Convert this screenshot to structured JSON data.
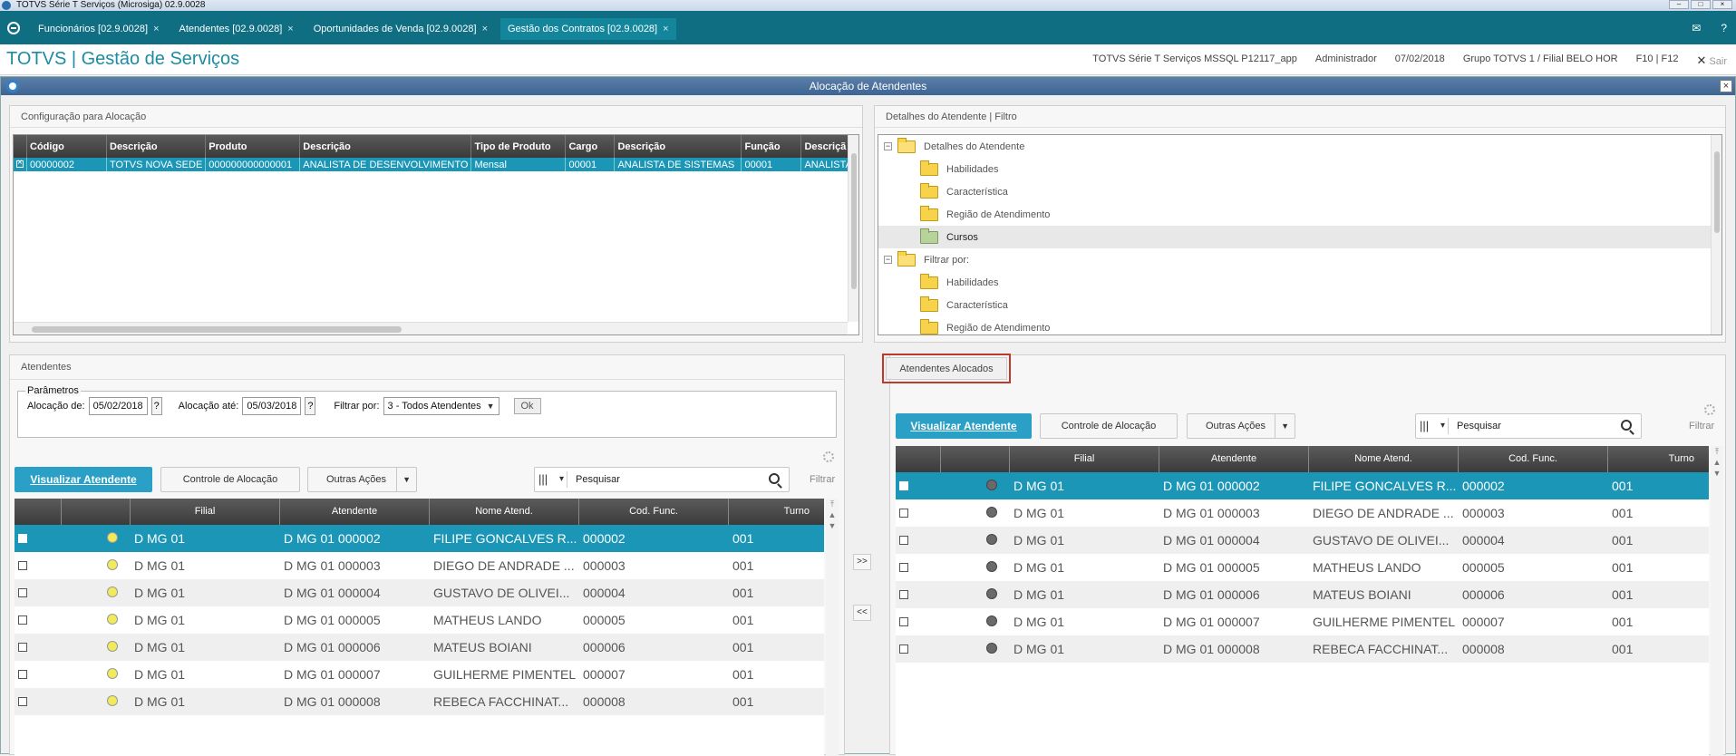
{
  "os": {
    "title": "TOTVS Série T Serviços (Microsiga) 02.9.0028"
  },
  "tabs": [
    {
      "label": "Funcionários [02.9.0028]"
    },
    {
      "label": "Atendentes [02.9.0028]"
    },
    {
      "label": "Oportunidades de Venda [02.9.0028]"
    },
    {
      "label": "Gestão dos Contratos [02.9.0028]"
    }
  ],
  "header": {
    "brand": "TOTVS | Gestão de Serviços",
    "environment": "TOTVS Série T Serviços MSSQL P12117_app",
    "user": "Administrador",
    "date": "07/02/2018",
    "company": "Grupo TOTVS 1 / Filial BELO HOR",
    "keys": "F10 | F12",
    "logout": "Sair"
  },
  "dialog": {
    "title": "Alocação de Atendentes"
  },
  "config": {
    "title": "Configuração para Alocação",
    "columns": [
      "Código",
      "Descrição",
      "Produto",
      "Descrição",
      "Tipo de Produto",
      "Cargo",
      "Descrição",
      "Função",
      "Descriçã"
    ],
    "row": [
      "00000002",
      "TOTVS NOVA SEDE",
      "000000000000001",
      "ANALISTA DE DESENVOLVIMENTO",
      "Mensal",
      "00001",
      "ANALISTA DE SISTEMAS",
      "00001",
      "ANALISTA"
    ]
  },
  "details": {
    "title": "Detalhes do Atendente | Filtro",
    "tree": [
      {
        "label": "Detalhes do Atendente",
        "level": 0
      },
      {
        "label": "Habilidades",
        "level": 1
      },
      {
        "label": "Característica",
        "level": 1
      },
      {
        "label": "Região de Atendimento",
        "level": 1
      },
      {
        "label": "Cursos",
        "level": 1,
        "selected": true
      },
      {
        "label": "Filtrar por:",
        "level": 0
      },
      {
        "label": "Habilidades",
        "level": 1
      },
      {
        "label": "Característica",
        "level": 1
      },
      {
        "label": "Região de Atendimento",
        "level": 1
      }
    ]
  },
  "atendentes": {
    "title": "Atendentes",
    "params": {
      "legend": "Parâmetros",
      "from_label": "Alocação de:",
      "from_value": "05/02/2018",
      "to_label": "Alocação até:",
      "to_value": "05/03/2018",
      "filter_label": "Filtrar por:",
      "filter_value": "3 - Todos Atendentes",
      "ok_label": "Ok"
    }
  },
  "toolbar": {
    "view_label": "Visualizar Atendente",
    "control_label": "Controle de Alocação",
    "more_label": "Outras Ações",
    "search_placeholder": "Pesquisar",
    "filter_label": "Filtrar"
  },
  "grid_columns": [
    "Filial",
    "Atendente",
    "Nome Atend.",
    "Cod. Func.",
    "Turno"
  ],
  "grid_rows": [
    [
      "D MG 01",
      "D MG 01 000002",
      "FILIPE GONCALVES R...",
      "000002",
      "001"
    ],
    [
      "D MG 01",
      "D MG 01 000003",
      "DIEGO DE ANDRADE ...",
      "000003",
      "001"
    ],
    [
      "D MG 01",
      "D MG 01 000004",
      "GUSTAVO DE OLIVEI...",
      "000004",
      "001"
    ],
    [
      "D MG 01",
      "D MG 01 000005",
      "MATHEUS LANDO",
      "000005",
      "001"
    ],
    [
      "D MG 01",
      "D MG 01 000006",
      "MATEUS BOIANI",
      "000006",
      "001"
    ],
    [
      "D MG 01",
      "D MG 01 000007",
      "GUILHERME PIMENTEL",
      "000007",
      "001"
    ],
    [
      "D MG 01",
      "D MG 01 000008",
      "REBECA FACCHINAT...",
      "000008",
      "001"
    ]
  ],
  "alocados": {
    "tab_label": "Atendentes Alocados"
  },
  "move": {
    "add": ">>",
    "remove": "<<"
  },
  "colors": {
    "accent": "#1b96b6",
    "primary_button": "#2aa0c6",
    "tabbar": "#0f6e82",
    "highlight_border": "#c0392b"
  }
}
